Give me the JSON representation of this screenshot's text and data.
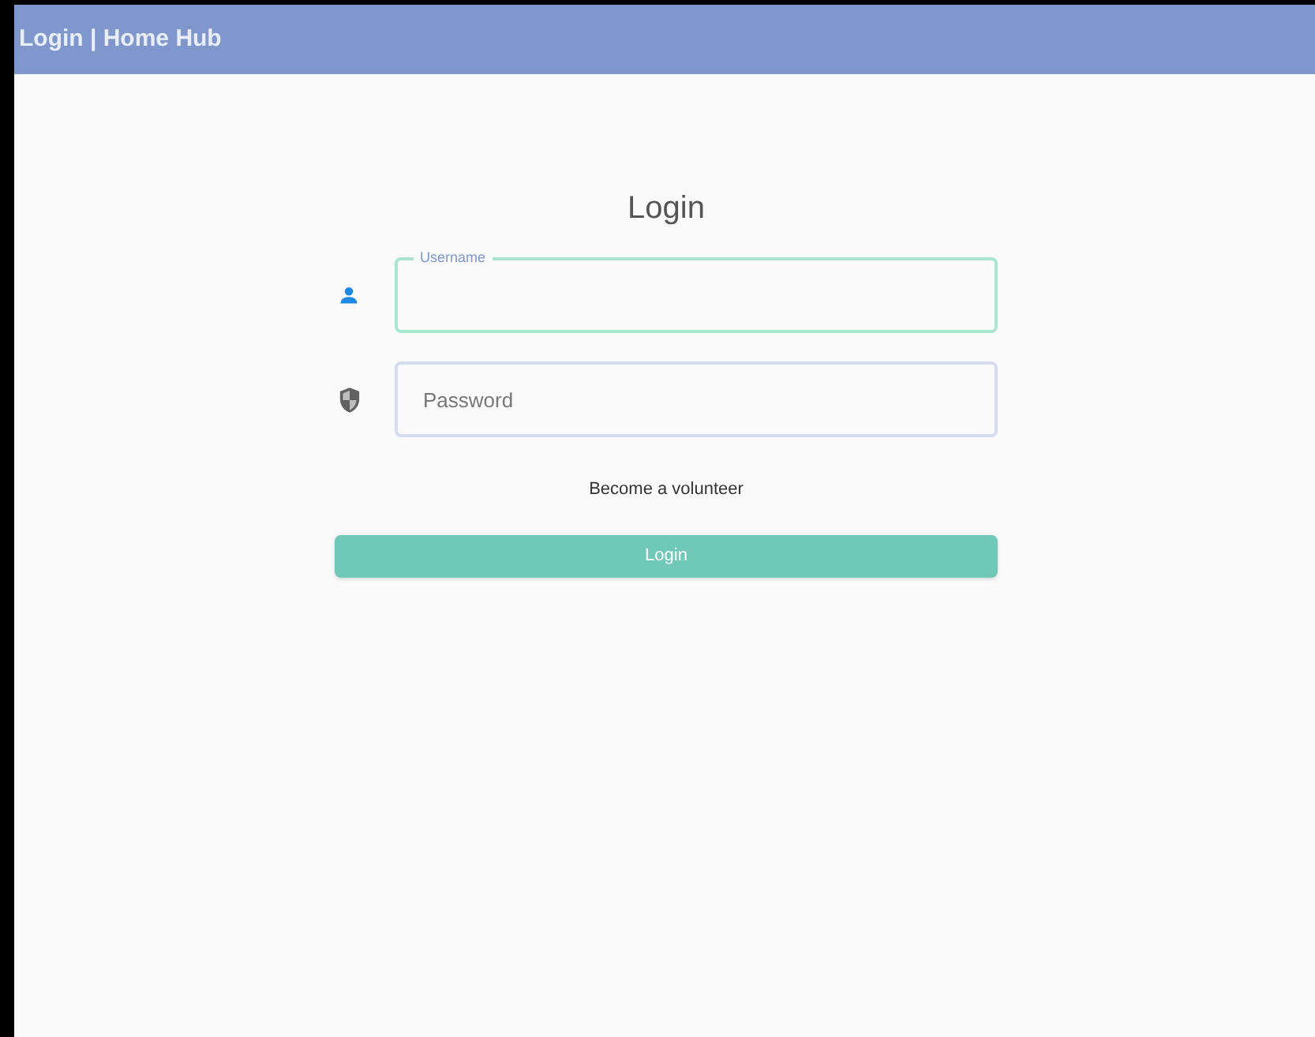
{
  "window": {
    "title": "Login | Home Hub"
  },
  "form": {
    "heading": "Login",
    "fields": [
      {
        "kind": "username",
        "label": "Username",
        "focused": true
      },
      {
        "kind": "password",
        "placeholder": "Password",
        "focused": false
      }
    ],
    "link": "Become a volunteer",
    "button": "Login"
  }
}
